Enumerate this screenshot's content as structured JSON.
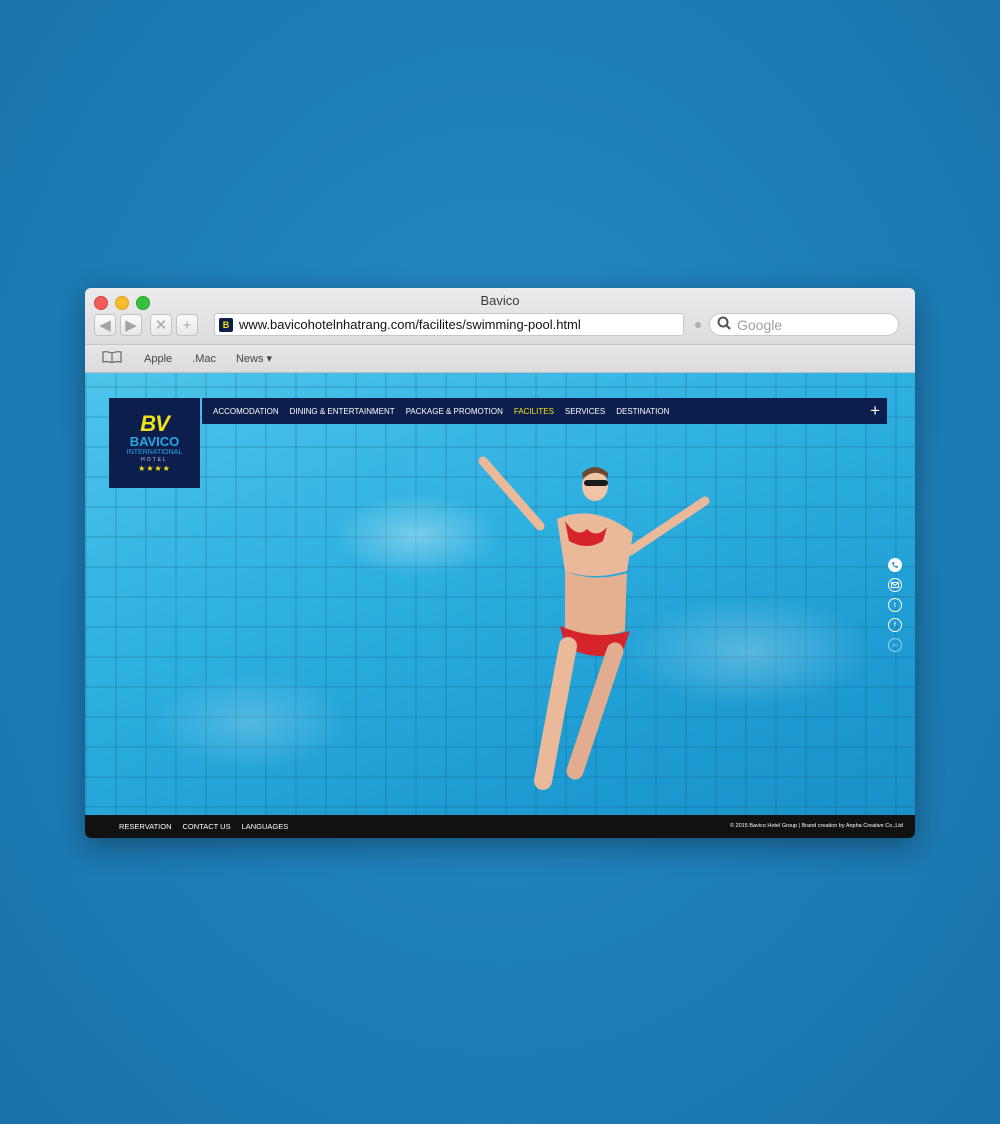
{
  "window": {
    "title": "Bavico"
  },
  "toolbar": {
    "back_label": "◀",
    "forward_label": "▶",
    "stop_label": "✕",
    "add_label": "+",
    "url": "www.bavicohotelnhatrang.com/facilites/swimming-pool.html",
    "search_placeholder": "Google"
  },
  "bookmarks": {
    "items": [
      "Apple",
      ".Mac",
      "News ▾"
    ]
  },
  "site": {
    "logo": {
      "mark": "BV",
      "name": "BAVICO",
      "subtitle": "INTERNATIONAL",
      "hotel": "HOTEL",
      "stars": "★★★★"
    },
    "nav": {
      "items": [
        "ACCOMODATION",
        "DINING & ENTERTAINMENT",
        "PACKAGE & PROMOTION",
        "FACILITES",
        "SERVICES",
        "DESTINATION"
      ],
      "active": "FACILITES",
      "plus_label": "+"
    },
    "social_icons": [
      "phone-icon",
      "mail-icon",
      "twitter-icon",
      "facebook-icon",
      "tripadvisor-icon"
    ],
    "footer": {
      "links": [
        "RESERVATION",
        "CONTACT US",
        "LANGUAGES"
      ],
      "copyright": "© 2015 Bavico Hotel Group  |  Brand creation by Anpha Creative Co.,Ltd"
    }
  },
  "colors": {
    "brand_navy": "#0c1f4c",
    "brand_yellow": "#f3e21a",
    "brand_blue": "#28a7e6",
    "footer_black": "#111111",
    "pool_blue": "#2eb0e0"
  }
}
